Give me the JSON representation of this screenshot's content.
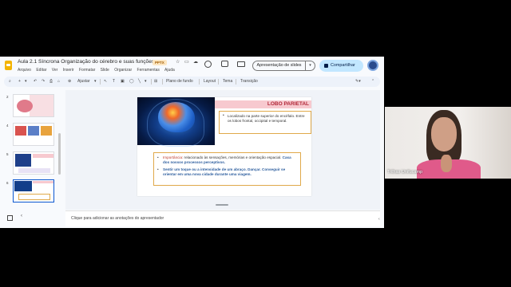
{
  "app": {
    "doc_title": "Aula 2.1 Síncrona Organização do cérebro e suas funções.",
    "file_badge": "PPTX",
    "menu": [
      "Arquivo",
      "Editar",
      "Ver",
      "Inserir",
      "Formatar",
      "Slide",
      "Organizar",
      "Ferramentas",
      "Ajuda"
    ],
    "present_label": "Apresentação de slides",
    "share_label": "Compartilhar",
    "present_arrow": "▾",
    "toolbar": {
      "zoom_label": "Ajustar",
      "background_label": "Plano de fundo",
      "layout_label": "Layout",
      "theme_label": "Tema",
      "transition_label": "Transição"
    },
    "slide_numbers": [
      "2",
      "4",
      "5",
      "6"
    ],
    "notes_placeholder": "Clique para adicionar as anotações do apresentador"
  },
  "slide": {
    "title": "LOBO PARIETAL",
    "box1_text": "Localizado na parte superior do encéfalo. Entre os lobos frontal, occipital e temporal.",
    "p1_label": "Importância:",
    "p1_text": " relacionado às sensações, memórias e orientação espacial.",
    "p1_bold": " Casa dos nossos processos perceptivos.",
    "p2_text": "Sentir um toque ou a intensidade de um abraço. Dançar. Conseguir se orientar em uma nova cidade durante uma viagem."
  },
  "webcam": {
    "name": "Trilhas Unifucamp"
  },
  "colors": {
    "accent": "#0b57d0",
    "share_bg": "#c2e7ff",
    "slide_title": "#b22a3a",
    "title_bar": "#f7c9cf",
    "box_border": "#e0a94a"
  }
}
